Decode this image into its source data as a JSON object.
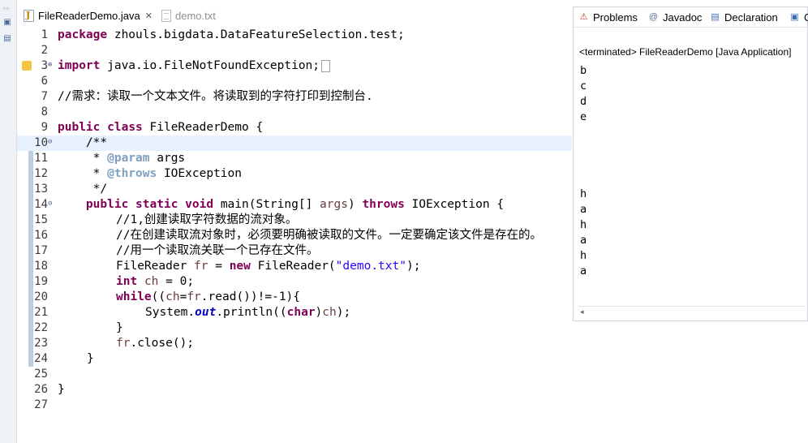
{
  "editor": {
    "tabs": [
      {
        "label": "FileReaderDemo.java",
        "active": true,
        "icon": "java-file-icon"
      },
      {
        "label": "demo.txt",
        "active": false,
        "icon": "text-file-icon"
      }
    ],
    "tab_close_glyph": "✕",
    "lines": [
      {
        "n": "1"
      },
      {
        "n": "2"
      },
      {
        "n": "3"
      },
      {
        "n": "6"
      },
      {
        "n": "7"
      },
      {
        "n": "8"
      },
      {
        "n": "9"
      },
      {
        "n": "10"
      },
      {
        "n": "11"
      },
      {
        "n": "12"
      },
      {
        "n": "13"
      },
      {
        "n": "14"
      },
      {
        "n": "15"
      },
      {
        "n": "16"
      },
      {
        "n": "17"
      },
      {
        "n": "18"
      },
      {
        "n": "19"
      },
      {
        "n": "20"
      },
      {
        "n": "21"
      },
      {
        "n": "22"
      },
      {
        "n": "23"
      },
      {
        "n": "24"
      },
      {
        "n": "25"
      },
      {
        "n": "26"
      },
      {
        "n": "27"
      }
    ],
    "code": {
      "l1_kw": "package",
      "l1_rest": " zhouls.bigdata.DataFeatureSelection.test;",
      "l3_kw": "import",
      "l3_rest": " java.io.FileNotFoundException;",
      "l7_comment": "//需求：读取一个文本文件。将读取到的字符打印到控制台.",
      "l9_kw1": "public",
      "l9_kw2": "class",
      "l9_rest": " FileReaderDemo {",
      "l10": "    /**",
      "l11_a": "     * ",
      "l11_tag": "@param",
      "l11_b": " args",
      "l12_a": "     * ",
      "l12_tag": "@throws",
      "l12_b": " IOException",
      "l13": "     */",
      "l14_kw1": "public",
      "l14_kw2": "static",
      "l14_kw3": "void",
      "l14_a": " main(String[] ",
      "l14_var": "args",
      "l14_b": ") ",
      "l14_kw4": "throws",
      "l14_c": " IOException {",
      "l15": "//1,创建读取字符数据的流对象。",
      "l16": "//在创建读取流对象时，必须要明确被读取的文件。一定要确定该文件是存在的。",
      "l17": "//用一个读取流关联一个已存在文件。",
      "l18_a": "FileReader ",
      "l18_var": "fr",
      "l18_b": " = ",
      "l18_kw": "new",
      "l18_c": " FileReader(",
      "l18_str": "\"demo.txt\"",
      "l18_d": ");",
      "l19_kw": "int",
      "l19_var": "ch",
      "l19_rest": " = 0;",
      "l20_kw": "while",
      "l20_a": "((",
      "l20_var1": "ch",
      "l20_b": "=",
      "l20_var2": "fr",
      "l20_c": ".read())!=-1){",
      "l21_a": "System.",
      "l21_fld": "out",
      "l21_b": ".println((",
      "l21_kw": "char",
      "l21_c": ")",
      "l21_var": "ch",
      "l21_d": ");",
      "l22": "}",
      "l23_var": "fr",
      "l23_rest": ".close();",
      "l24": "}",
      "l26": "}"
    }
  },
  "views": {
    "tabs": [
      {
        "label": "Problems",
        "icon": "problems-icon"
      },
      {
        "label": "Javadoc",
        "icon": "at-sign-icon"
      },
      {
        "label": "Declaration",
        "icon": "declaration-icon"
      },
      {
        "label": "C",
        "icon": "console-icon"
      }
    ],
    "console": {
      "header": "<terminated> FileReaderDemo [Java Application]",
      "output": [
        "b",
        "c",
        "d",
        "e",
        "",
        "",
        "",
        "",
        "h",
        "a",
        "h",
        "a",
        "h",
        "a"
      ]
    },
    "scroll_left_glyph": "◂"
  }
}
